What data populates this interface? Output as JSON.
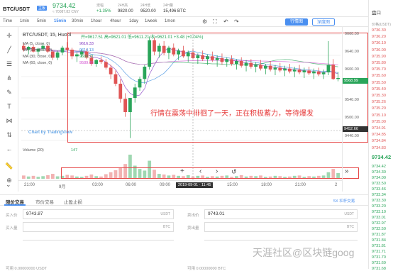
{
  "header": {
    "pair": "BTC/USDT",
    "tag": "主板",
    "price": "9734.42",
    "cny": "≈ 70087.82 CNY",
    "stats": [
      {
        "label": "涨幅",
        "value": "+1.35%"
      },
      {
        "label": "24H高",
        "value": "9820.00"
      },
      {
        "label": "24H低",
        "value": "9520.00"
      },
      {
        "label": "24H量",
        "value": "15,496 BTC"
      }
    ],
    "btn_line": "行情图",
    "btn_depth": "深度图"
  },
  "timeframes": [
    "Time",
    "1min",
    "5min",
    "15min",
    "30min",
    "1hour",
    "4hour",
    "1day",
    "1week",
    "1mon"
  ],
  "active_timeframe": "15min",
  "legend": {
    "title": "BTC/USDT, 15, Huobi",
    "ohlc": "开=9617.51  高=9621.01  低=9611.21  收=9621.01  +3.48 (+0.04%)",
    "ma": [
      {
        "name": "MA (5, close, 0)",
        "value": "9616.33",
        "color": "#7b2fbe"
      },
      {
        "name": "MA (10, close, 0)",
        "value": "9614.13",
        "color": "#3b8de0"
      },
      {
        "name": "MA (30, close, 0)",
        "value": "9600.71",
        "color": "#2aa55a"
      },
      {
        "name": "MA (60, close, 0)",
        "value": "9589.45",
        "color": "#d24fd0"
      }
    ],
    "volume": "Volume (20)",
    "volume_value": "147"
  },
  "annotation": "行情在震荡中徘徊了一天，正在积极蓄力，等待爆发",
  "tradingview": "Chart by TradingView",
  "yaxis_prices": [
    "9660.00",
    "9640.00",
    "9620.00",
    "9600.00",
    "9580.00",
    "9560.00",
    "9540.00",
    "9520.00",
    "9500.00",
    "9480.00",
    "9460.00",
    "9440.00"
  ],
  "price_tags": {
    "current": "9568.99",
    "cross": "9452.66"
  },
  "xaxis": [
    "21:00",
    "9月",
    "03:00",
    "06:00",
    "09:00",
    "2019-09-01 · 11:45",
    "15:00",
    "18:00",
    "21:00",
    "2"
  ],
  "chart_data": {
    "type": "candlestick",
    "ylim": [
      9440,
      9665
    ],
    "candles": [
      [
        9640,
        9645,
        9628,
        9632
      ],
      [
        9632,
        9640,
        9622,
        9638
      ],
      [
        9638,
        9642,
        9626,
        9628
      ],
      [
        9628,
        9636,
        9620,
        9634
      ],
      [
        9634,
        9646,
        9630,
        9640
      ],
      [
        9640,
        9643,
        9625,
        9628
      ],
      [
        9628,
        9632,
        9610,
        9615
      ],
      [
        9615,
        9630,
        9610,
        9626
      ],
      [
        9626,
        9640,
        9620,
        9636
      ],
      [
        9636,
        9648,
        9630,
        9632
      ],
      [
        9632,
        9636,
        9612,
        9618
      ],
      [
        9618,
        9626,
        9606,
        9622
      ],
      [
        9622,
        9632,
        9616,
        9628
      ],
      [
        9628,
        9634,
        9612,
        9615
      ],
      [
        9615,
        9620,
        9598,
        9602
      ],
      [
        9602,
        9612,
        9596,
        9610
      ],
      [
        9610,
        9618,
        9602,
        9606
      ],
      [
        9606,
        9612,
        9590,
        9594
      ],
      [
        9594,
        9600,
        9570,
        9580
      ],
      [
        9580,
        9588,
        9555,
        9560
      ],
      [
        9560,
        9570,
        9520,
        9528
      ],
      [
        9528,
        9540,
        9490,
        9500
      ],
      [
        9500,
        9520,
        9445,
        9530
      ],
      [
        9530,
        9560,
        9520,
        9552
      ],
      [
        9552,
        9575,
        9545,
        9570
      ],
      [
        9570,
        9600,
        9560,
        9596
      ],
      [
        9596,
        9660,
        9590,
        9652
      ],
      [
        9652,
        9658,
        9620,
        9628
      ],
      [
        9628,
        9645,
        9615,
        9640
      ],
      [
        9640,
        9650,
        9620,
        9625
      ],
      [
        9625,
        9640,
        9612,
        9636
      ],
      [
        9636,
        9645,
        9618,
        9622
      ],
      [
        9622,
        9634,
        9610,
        9630
      ],
      [
        9630,
        9640,
        9615,
        9618
      ],
      [
        9618,
        9630,
        9606,
        9626
      ],
      [
        9626,
        9634,
        9612,
        9614
      ],
      [
        9614,
        9624,
        9602,
        9620
      ],
      [
        9620,
        9630,
        9608,
        9612
      ],
      [
        9612,
        9622,
        9600,
        9618
      ],
      [
        9618,
        9628,
        9606,
        9610
      ],
      [
        9610,
        9620,
        9596,
        9614
      ],
      [
        9614,
        9624,
        9600,
        9606
      ],
      [
        9606,
        9616,
        9596,
        9612
      ],
      [
        9612,
        9620,
        9598,
        9602
      ],
      [
        9602,
        9612,
        9590,
        9608
      ],
      [
        9608,
        9616,
        9594,
        9598
      ],
      [
        9598,
        9610,
        9586,
        9604
      ],
      [
        9604,
        9612,
        9592,
        9596
      ],
      [
        9596,
        9606,
        9584,
        9600
      ],
      [
        9600,
        9610,
        9588,
        9592
      ],
      [
        9592,
        9602,
        9580,
        9598
      ],
      [
        9598,
        9608,
        9586,
        9590
      ],
      [
        9590,
        9600,
        9578,
        9594
      ],
      [
        9594,
        9604,
        9584,
        9588
      ],
      [
        9588,
        9598,
        9576,
        9592
      ],
      [
        9592,
        9602,
        9582,
        9586
      ],
      [
        9586,
        9596,
        9574,
        9590
      ],
      [
        9590,
        9600,
        9580,
        9584
      ],
      [
        9584,
        9594,
        9572,
        9588
      ],
      [
        9588,
        9596,
        9578,
        9582
      ],
      [
        9582,
        9592,
        9570,
        9586
      ],
      [
        9586,
        9594,
        9576,
        9580
      ],
      [
        9580,
        9590,
        9570,
        9584
      ],
      [
        9584,
        9650,
        9578,
        9600
      ],
      [
        9600,
        9612,
        9568,
        9570
      ],
      [
        9570,
        9585,
        9565,
        9572
      ]
    ],
    "volumes": [
      20,
      14,
      18,
      12,
      16,
      22,
      30,
      15,
      18,
      24,
      20,
      14,
      12,
      18,
      26,
      16,
      14,
      28,
      40,
      52,
      70,
      90,
      147,
      80,
      60,
      50,
      110,
      55,
      30,
      26,
      20,
      24,
      18,
      16,
      22,
      14,
      18,
      20,
      12,
      16,
      14,
      18,
      20,
      12,
      16,
      22,
      14,
      18,
      16,
      20,
      12,
      14,
      18,
      16,
      12,
      14,
      18,
      20,
      12,
      16,
      14,
      18,
      20,
      40,
      60,
      35
    ]
  },
  "trade": {
    "tabs": [
      "限价交易",
      "市价交易",
      "止盈止损"
    ],
    "leverage": "5X 杠杆交易",
    "buy_price_label": "买入价",
    "buy_price": "9743.87",
    "buy_amount_label": "买入量",
    "sell_price_label": "卖出价",
    "sell_price": "9743.01",
    "sell_amount_label": "卖出量",
    "unit_usdt": "USDT",
    "unit_btc": "BTC",
    "avail_buy": "可用 0.00000000 USDT",
    "avail_sell": "可用 0.00000000 BTC"
  },
  "orderbook": {
    "title": "盘口",
    "sub": "价格(USDT)",
    "asks": [
      "9736.30",
      "9736.20",
      "9736.10",
      "9736.00",
      "9735.90",
      "9735.80",
      "9735.70",
      "9735.60",
      "9735.50",
      "9735.40",
      "9735.30",
      "9735.26",
      "9735.20",
      "9735.10",
      "9735.00",
      "9734.91",
      "9734.85",
      "9734.84",
      "9734.83"
    ],
    "mid": "9734.42",
    "mid_sub": "70...",
    "bids": [
      "9734.42",
      "9734.30",
      "9734.00",
      "9733.50",
      "9733.46",
      "9733.34",
      "9733.30",
      "9733.20",
      "9733.10",
      "9733.01",
      "9732.97",
      "9732.50",
      "9731.87",
      "9731.84",
      "9731.81",
      "9731.71",
      "9731.70",
      "9731.69",
      "9731.68"
    ]
  },
  "watermark": "天涯社区@区块链goog"
}
